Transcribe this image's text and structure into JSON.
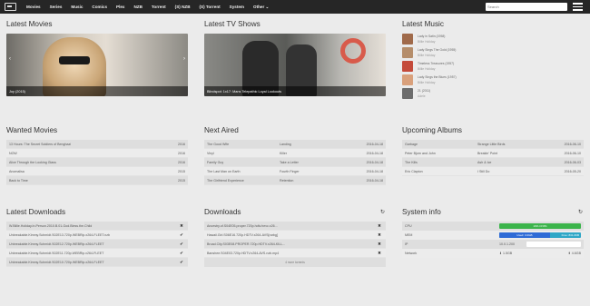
{
  "nav": {
    "items": [
      "Movies",
      "Series",
      "Music",
      "Comics",
      "Plex",
      "NZB",
      "Torrent",
      "(S) NZB",
      "(S) Torrent",
      "System",
      "Other"
    ],
    "search_placeholder": "Search"
  },
  "latest_movies": {
    "title": "Latest Movies",
    "caption": "Joy (2015)"
  },
  "latest_tv": {
    "title": "Latest TV Shows",
    "caption": "Blindspot: 1x17: Mans Telepathic Loyal Lookouts"
  },
  "latest_music": {
    "title": "Latest Music",
    "items": [
      {
        "track": "Lady in Satin (1958)",
        "artist": "Billie Holiday"
      },
      {
        "track": "Lady Sings The Gold (1955)",
        "artist": "Billie Holiday"
      },
      {
        "track": "Timeless Treasures (1957)",
        "artist": "Billie Holiday"
      },
      {
        "track": "Lady Sings the Blues (1957)",
        "artist": "Billie Holiday"
      },
      {
        "track": "21 (2011)",
        "artist": "Adele"
      }
    ]
  },
  "wanted_movies": {
    "title": "Wanted Movies",
    "rows": [
      {
        "name": "13 Hours: The Secret Soldiers of Benghazi",
        "year": "2016"
      },
      {
        "name": "NOW",
        "year": "2016"
      },
      {
        "name": "Alice Through the Looking Glass",
        "year": "2016"
      },
      {
        "name": "Anomalisa",
        "year": "2015"
      },
      {
        "name": "Back to Time",
        "year": "2015"
      }
    ]
  },
  "next_aired": {
    "title": "Next Aired",
    "rows": [
      {
        "show": "The Good Wife",
        "episode": "Landing",
        "date": "2016-04-18"
      },
      {
        "show": "Vinyl",
        "episode": "Killer",
        "date": "2016-04-18"
      },
      {
        "show": "Family Guy",
        "episode": "Take a Letter",
        "date": "2016-04-18"
      },
      {
        "show": "The Last Man on Earth",
        "episode": "Fourth Finger",
        "date": "2016-04-18"
      },
      {
        "show": "The Girlfriend Experience",
        "episode": "Retention",
        "date": "2016-04-18"
      }
    ]
  },
  "upcoming_albums": {
    "title": "Upcoming Albums",
    "rows": [
      {
        "artist": "Garbage",
        "album": "Strange Little Birds",
        "date": "2016-06-10"
      },
      {
        "artist": "Peter Bjorn and John",
        "album": "Breakin' Point",
        "date": "2016-06-10"
      },
      {
        "artist": "The Kills",
        "album": "Ash & Ice",
        "date": "2016-06-03"
      },
      {
        "artist": "Eric Clapton",
        "album": "I Still Do",
        "date": "2016-05-20"
      }
    ]
  },
  "latest_downloads": {
    "title": "Latest Downloads",
    "rows": [
      "W.Billie.Holiday.In.Person.2010.B.01-God.Bless.the.Child",
      "Unbreakable.Kimmy.Schmidt.S02E13.720p.WEBRip.x264-FLEET.nzb",
      "Unbreakable.Kimmy.Schmidt.S02E12.720p.WEBRip.x264-FLEET",
      "Unbreakable.Kimmy.Schmidt.S02E11.720p.WEBRip.x264-FLEET",
      "Unbreakable.Kimmy.Schmidt.S02E10.720p.WEBRip.x264-FLEET"
    ]
  },
  "downloads": {
    "title": "Downloads",
    "rows": [
      "Ancestry.of.S04E05.proper.720p.hdtv.hevc.x26...",
      "Hawaii.Girl.S06E16.720p.HDTV.x264-AVS[rarbg]",
      "Broad.City.S03E08.PROPER.720p.HDTV.x264-KILL...",
      "Banshee.S04E03.720p.HDTV.x264-AVS.nzb.mp4"
    ],
    "more": "4 more torrents"
  },
  "system_info": {
    "title": "System info",
    "rows": [
      {
        "label": "CPU",
        "bar_text": "16% Of 8%",
        "fill": 1.0,
        "color": "#3cb44b"
      },
      {
        "label": "MEM",
        "bar_text": "Used: 3.0GB",
        "bar_text2": "Free: 831.0KB",
        "fill": 0.62,
        "color": "#2f6bd6",
        "color2": "#2fa7c7"
      },
      {
        "label": "IP",
        "value": "10.0.1.200",
        "fill": 0.0
      },
      {
        "label": "Network",
        "down": "1.5GB",
        "up": "4.6GB"
      }
    ]
  }
}
